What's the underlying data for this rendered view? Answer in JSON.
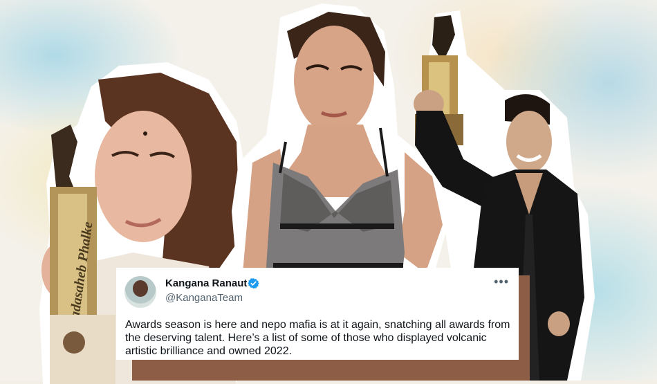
{
  "tweet": {
    "author_name": "Kangana Ranaut",
    "author_handle": "@KanganaTeam",
    "more_icon": "•••",
    "text": "Awards season is here and nepo mafia is at it again, snatching all awards from the deserving talent. Here’s a list of some of those who displayed volcanic artistic brilliance and owned 2022."
  },
  "trophy_left": {
    "text": "Dadasaheb Phalke"
  },
  "colors": {
    "tweet_shadow": "#8d5e45",
    "verified_blue": "#1d9bf0",
    "background": "#f4f1ea"
  }
}
